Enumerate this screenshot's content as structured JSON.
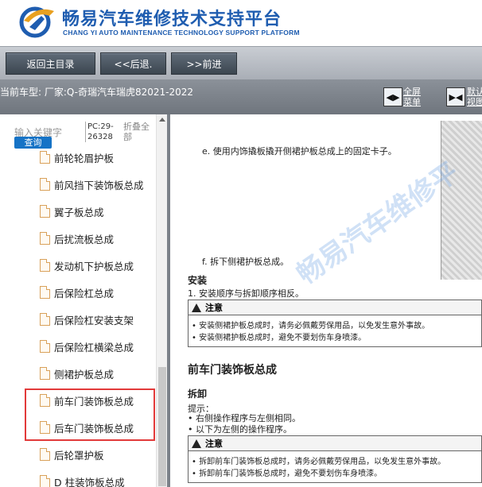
{
  "header": {
    "title": "畅易汽车维修技术支持平台",
    "subtitle": "CHANG YI AUTO MAINTENANCE TECHNOLOGY SUPPORT PLATFORM",
    "logo_icon": "cy-logo-icon"
  },
  "toolbar": {
    "home_label": "返回主目录",
    "back_label": "<<后退.",
    "forward_label": ">>前进"
  },
  "vehicle_bar": {
    "text": "当前车型:  厂家:Q-奇瑞汽车瑞虎82021-2022",
    "fullscreen_label_1": "全屏",
    "fullscreen_label_2": "菜单",
    "default_label_1": "默认",
    "default_label_2": "视图"
  },
  "sidebar": {
    "keyword_placeholder": "输入关键字",
    "query_label": "查询",
    "pc_code_1": "PC:29-",
    "pc_code_2": "26328",
    "fold_all_1": "折叠全",
    "fold_all_2": "部",
    "items": [
      {
        "label": "前轮轮眉护板"
      },
      {
        "label": "前风挡下装饰板总成"
      },
      {
        "label": "翼子板总成"
      },
      {
        "label": "后扰流板总成"
      },
      {
        "label": "发动机下护板总成"
      },
      {
        "label": "后保险杠总成"
      },
      {
        "label": "后保险杠安装支架"
      },
      {
        "label": "后保险杠横梁总成"
      },
      {
        "label": "侧裙护板总成"
      },
      {
        "label": "前车门装饰板总成"
      },
      {
        "label": "后车门装饰板总成"
      },
      {
        "label": "后轮罩护板"
      },
      {
        "label": "D 柱装饰板总成"
      }
    ]
  },
  "content": {
    "watermark": "畅易汽车维修平",
    "step_e": "e.  使用内饰撬板撬开侧裙护板总成上的固定卡子。",
    "step_f": "f.   拆下侧裙护板总成。",
    "install_heading": "安装",
    "install_step": "1.  安装顺序与拆卸顺序相反。",
    "note_label": "注意",
    "note1_line1": "•   安装侧裙护板总成时，请务必佩戴劳保用品，以免发生意外事故。",
    "note1_line2": "•   安装侧裙护板总成时，避免不要划伤车身喷漆。",
    "section_title": "前车门装饰板总成",
    "remove_heading": "拆卸",
    "hint_label": "提示：",
    "hint_line1": "•   右侧操作程序与左侧相同。",
    "hint_line2": "•   以下为左侧的操作程序。",
    "note2_line1": "•   拆卸前车门装饰板总成时，请务必佩戴劳保用品，以免发生意外事故。",
    "note2_line2": "•   拆卸前车门装饰板总成时，避免不要划伤车身喷漆。"
  }
}
